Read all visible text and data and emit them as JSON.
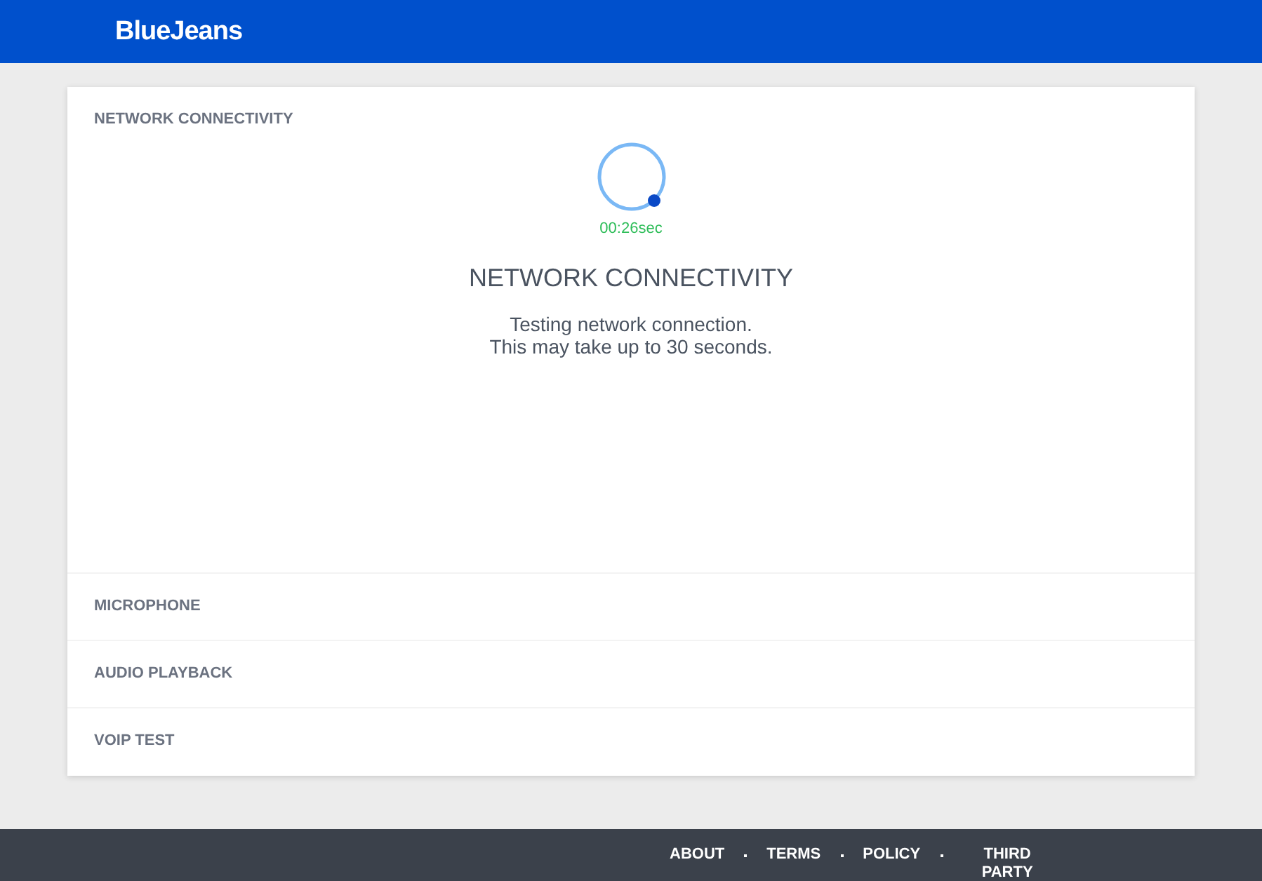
{
  "header": {
    "logo": "BlueJeans"
  },
  "sections": [
    {
      "title": "NETWORK CONNECTIVITY",
      "expanded": true,
      "timer": "00:26sec",
      "heading": "NETWORK CONNECTIVITY",
      "lines": [
        "Testing network connection.",
        "This may take up to 30 seconds."
      ]
    },
    {
      "title": "MICROPHONE",
      "expanded": false
    },
    {
      "title": "AUDIO PLAYBACK",
      "expanded": false
    },
    {
      "title": "VOIP TEST",
      "expanded": false
    }
  ],
  "footer": {
    "links": [
      "ABOUT",
      "TERMS",
      "POLICY",
      "THIRD PARTY"
    ]
  }
}
